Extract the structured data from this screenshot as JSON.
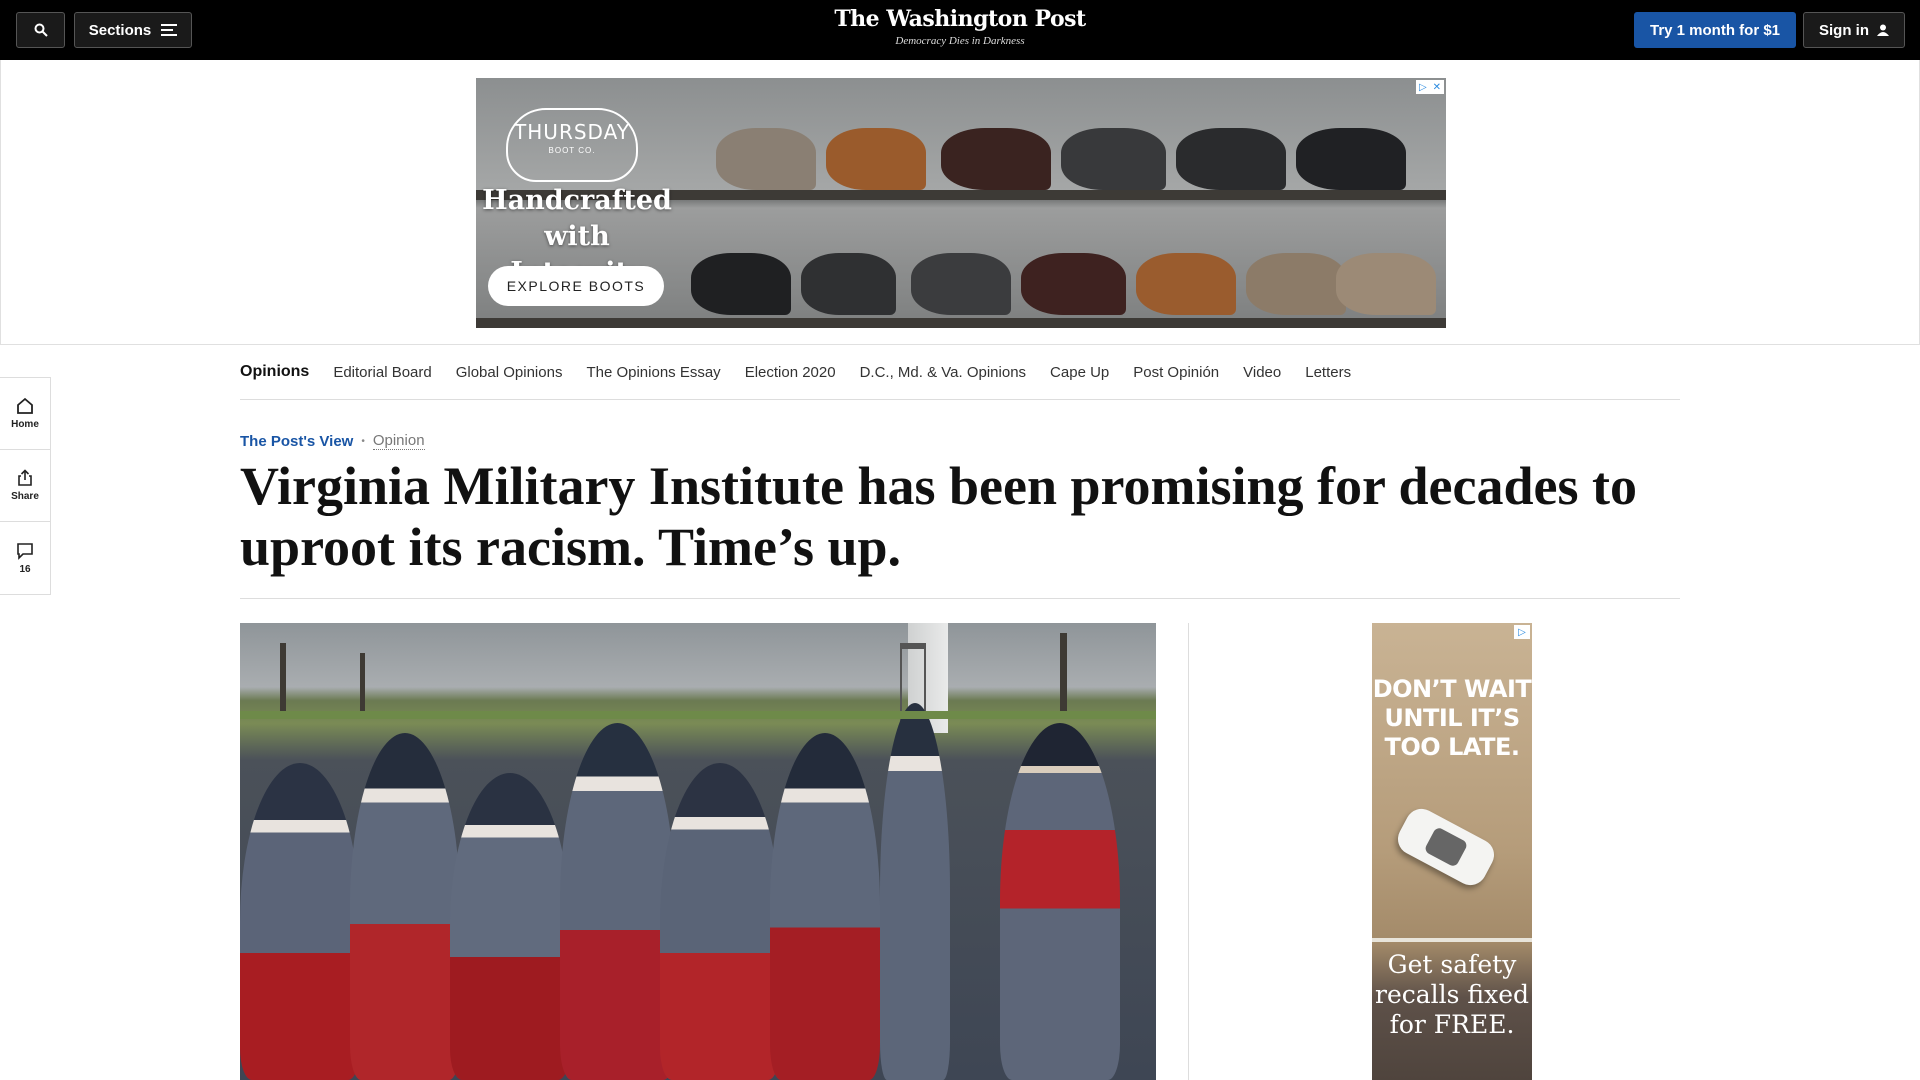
{
  "topbar": {
    "sections_label": "Sections",
    "logo": "The Washington Post",
    "tagline": "Democracy Dies in Darkness",
    "try_label": "Try 1 month for $1",
    "signin_label": "Sign in"
  },
  "top_ad": {
    "brand_line1": "THURSDAY",
    "brand_line2": "BOOT CO.",
    "headline": "Handcrafted with Integrity",
    "cta": "EXPLORE BOOTS"
  },
  "section_nav": {
    "items": [
      "Opinions",
      "Editorial Board",
      "Global Opinions",
      "The Opinions Essay",
      "Election 2020",
      "D.C., Md. & Va. Opinions",
      "Cape Up",
      "Post Opinión",
      "Video",
      "Letters"
    ]
  },
  "rail": {
    "home_label": "Home",
    "share_label": "Share",
    "comments_count": "16"
  },
  "article": {
    "kicker": "The Post's View",
    "kicker_separator": "•",
    "category": "Opinion",
    "headline": "Virginia Military Institute has been promising for decades to uproot its racism. Time’s up."
  },
  "side_ad": {
    "line1": "DON’T WAIT UNTIL IT’S TOO LATE.",
    "line2": "Get safety recalls fixed for FREE."
  },
  "colors": {
    "topbar_bg": "#000000",
    "accent_blue": "#1955a5",
    "rule": "#dddddd"
  },
  "icons": [
    "search-icon",
    "menu-icon",
    "user-icon",
    "home-icon",
    "share-icon",
    "comment-icon",
    "adchoices-icon"
  ]
}
